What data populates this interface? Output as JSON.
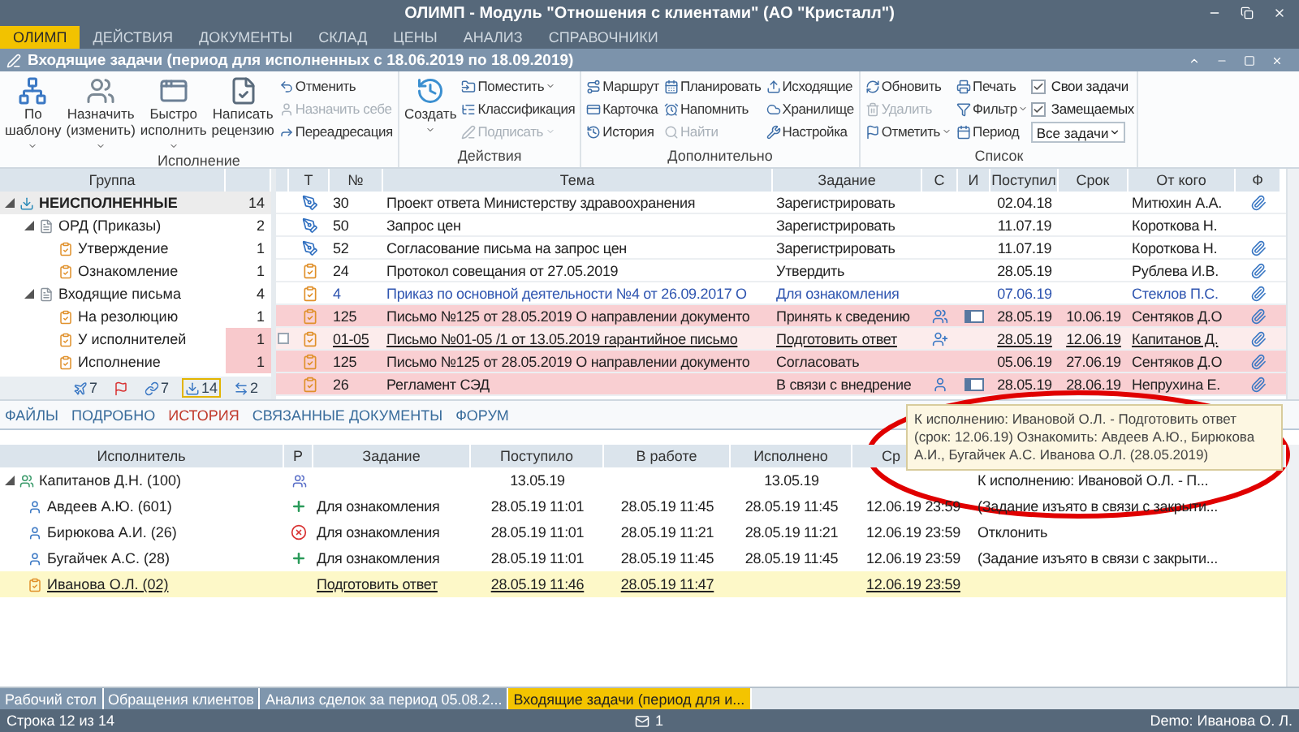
{
  "window": {
    "title": "ОЛИМП -  Модуль \"Отношения с клиентами\" (АО \"Кристалл\")"
  },
  "menu": [
    {
      "label": "ОЛИМП",
      "selected": true
    },
    {
      "label": "ДЕЙСТВИЯ",
      "selected": false
    },
    {
      "label": "ДОКУМЕНТЫ",
      "selected": false
    },
    {
      "label": "СКЛАД",
      "selected": false
    },
    {
      "label": "ЦЕНЫ",
      "selected": false
    },
    {
      "label": "АНАЛИЗ",
      "selected": false
    },
    {
      "label": "СПРАВОЧНИКИ",
      "selected": false
    }
  ],
  "document_title": "Входящие задачи (период для исполненных с 18.06.2019 по 18.09.2019)",
  "ribbon": {
    "groups": [
      {
        "label": "Исполнение",
        "items": [
          {
            "kind": "big",
            "label": "По шаблону",
            "dropdown": true
          },
          {
            "kind": "big",
            "label": "Назначить (изменить)",
            "dropdown": true
          },
          {
            "kind": "big",
            "label": "Быстро исполнить",
            "dropdown": true
          },
          {
            "kind": "big",
            "label": "Написать рецензию",
            "dropdown": false
          },
          {
            "kind": "column",
            "buttons": [
              {
                "label": "Отменить",
                "disabled": false,
                "dropdown": false
              },
              {
                "label": "Назначить себе",
                "disabled": true,
                "dropdown": false
              },
              {
                "label": "Переадресация",
                "disabled": false,
                "dropdown": false
              }
            ]
          }
        ]
      },
      {
        "label": "Действия",
        "items": [
          {
            "kind": "big",
            "label": "Создать",
            "dropdown": true
          },
          {
            "kind": "column",
            "buttons": [
              {
                "label": "Поместить",
                "disabled": false,
                "dropdown": true
              },
              {
                "label": "Классификация",
                "disabled": false,
                "dropdown": false
              },
              {
                "label": "Подписать",
                "disabled": true,
                "dropdown": true
              }
            ]
          }
        ]
      },
      {
        "label": "Дополнительно",
        "items": [
          {
            "kind": "column",
            "buttons": [
              {
                "label": "Маршрут",
                "disabled": false,
                "dropdown": false
              },
              {
                "label": "Карточка",
                "disabled": false,
                "dropdown": false
              },
              {
                "label": "История",
                "disabled": false,
                "dropdown": false
              }
            ]
          },
          {
            "kind": "column",
            "buttons": [
              {
                "label": "Планировать",
                "disabled": false,
                "dropdown": false
              },
              {
                "label": "Напомнить",
                "disabled": false,
                "dropdown": false
              },
              {
                "label": "Найти",
                "disabled": true,
                "dropdown": false
              }
            ]
          },
          {
            "kind": "column",
            "buttons": [
              {
                "label": "Исходящие",
                "disabled": false,
                "dropdown": false
              },
              {
                "label": "Хранилище",
                "disabled": false,
                "dropdown": false
              },
              {
                "label": "Настройка",
                "disabled": false,
                "dropdown": false
              }
            ]
          }
        ]
      },
      {
        "label": "Список",
        "items": [
          {
            "kind": "column",
            "buttons": [
              {
                "label": "Обновить",
                "disabled": false,
                "dropdown": false
              },
              {
                "label": "Удалить",
                "disabled": true,
                "dropdown": false
              },
              {
                "label": "Отметить",
                "disabled": false,
                "dropdown": true
              }
            ]
          },
          {
            "kind": "column",
            "buttons": [
              {
                "label": "Печать",
                "disabled": false,
                "dropdown": false
              },
              {
                "label": "Фильтр",
                "disabled": false,
                "dropdown": true
              },
              {
                "label": "Период",
                "disabled": false,
                "dropdown": false
              }
            ]
          },
          {
            "kind": "options",
            "checks": [
              {
                "label": "Свои задачи",
                "checked": true
              },
              {
                "label": "Замещаемых",
                "checked": true
              }
            ],
            "select": {
              "value": "Все задачи"
            }
          }
        ]
      }
    ]
  },
  "groups_panel": {
    "header": "Группа",
    "tree": [
      {
        "label": "НЕИСПОЛНЕННЫЕ",
        "count": "14",
        "expanded": true,
        "selected": true,
        "overdue": false,
        "children": [
          {
            "label": "ОРД (Приказы)",
            "count": "2",
            "expanded": true,
            "selected": false,
            "overdue": false,
            "children": [
              {
                "label": "Утверждение",
                "count": "1",
                "selected": false,
                "overdue": false
              },
              {
                "label": "Ознакомление",
                "count": "1",
                "selected": false,
                "overdue": false
              }
            ]
          },
          {
            "label": "Входящие письма",
            "count": "4",
            "expanded": true,
            "selected": false,
            "overdue": false,
            "children": [
              {
                "label": "На резолюцию",
                "count": "1",
                "selected": false,
                "overdue": false
              },
              {
                "label": "У исполнителей",
                "count": "1",
                "selected": false,
                "overdue": true
              },
              {
                "label": "Исполнение",
                "count": "1",
                "selected": false,
                "overdue": true
              }
            ]
          }
        ]
      }
    ],
    "counters": [
      {
        "count": "7",
        "selected": false
      },
      {
        "selected": false
      },
      {
        "count": "7",
        "selected": false
      },
      {
        "count": "14",
        "selected": true
      },
      {
        "count": "2",
        "selected": false
      }
    ]
  },
  "tasks_table": {
    "columns": [
      "Т",
      "№",
      "Тема",
      "Задание",
      "С",
      "И",
      "Поступил",
      "Срок",
      "От кого",
      "Ф"
    ],
    "rows": [
      {
        "kind": "registration",
        "num": "30",
        "topic": "Проект ответа Министерству здравоохранения",
        "task": "Зарегистрировать",
        "received": "02.04.18",
        "sender": "Митюхин А.А.",
        "attachment": true,
        "overdue": false,
        "unread": false,
        "selected": false
      },
      {
        "kind": "registration",
        "num": "50",
        "topic": "Запрос цен",
        "task": "Зарегистрировать",
        "received": "11.07.19",
        "sender": "Короткова Н.",
        "attachment": false,
        "overdue": false,
        "unread": false,
        "selected": false
      },
      {
        "kind": "registration",
        "num": "52",
        "topic": "Согласование письма на запрос цен",
        "task": "Зарегистрировать",
        "received": "11.07.19",
        "sender": "Короткова Н.",
        "attachment": true,
        "overdue": false,
        "unread": false,
        "selected": false
      },
      {
        "kind": "task",
        "num": "24",
        "topic": "Протокол совещания от 27.05.2019",
        "task": "Утвердить",
        "received": "28.05.19",
        "sender": "Рублева И.В.",
        "attachment": true,
        "overdue": false,
        "unread": false,
        "selected": false
      },
      {
        "kind": "task",
        "num": "4",
        "topic": "Приказ по основной деятельности №4 от 26.09.2017 О",
        "task": "Для ознакомления",
        "received": "07.06.19",
        "sender": "Стеклов П.С.",
        "attachment": true,
        "overdue": false,
        "unread": true,
        "selected": false
      },
      {
        "kind": "task",
        "num": "125",
        "topic": "Письмо №125 от 28.05.2019 О направлении документо",
        "task": "Принять к сведению",
        "signers": {
          "kind": "group"
        },
        "progress": true,
        "received": "28.05.19",
        "due": "10.06.19",
        "sender": "Сентяков Д.О",
        "attachment": true,
        "overdue": true,
        "unread": false,
        "selected": false
      },
      {
        "kind": "task",
        "num": "01-05",
        "topic": "Письмо №01-05 /1 от 13.05.2019 гарантийное письмо",
        "task": "Подготовить ответ",
        "signers": {
          "kind": "group_add"
        },
        "progress": false,
        "received": "28.05.19",
        "due": "12.06.19",
        "sender": "Капитанов Д.",
        "attachment": true,
        "overdue": true,
        "unread": false,
        "selected": true
      },
      {
        "kind": "task",
        "num": "125",
        "topic": "Письмо №125 от 28.05.2019 О направлении документо",
        "task": "Согласовать",
        "received": "05.06.19",
        "due": "27.06.19",
        "sender": "Сентяков Д.О",
        "attachment": true,
        "overdue": true,
        "unread": false,
        "selected": false
      },
      {
        "kind": "task",
        "num": "26",
        "topic": "Регламент СЭД",
        "task": "В связи с внедрение",
        "signers": {
          "kind": "person"
        },
        "progress": true,
        "received": "28.05.19",
        "due": "28.06.19",
        "sender": "Непрухина Е.",
        "attachment": true,
        "overdue": true,
        "unread": false,
        "selected": false
      }
    ]
  },
  "detail": {
    "tabs": [
      {
        "label": "ФАЙЛЫ",
        "selected": false
      },
      {
        "label": "ПОДРОБНО",
        "selected": false
      },
      {
        "label": "ИСТОРИЯ",
        "selected": true
      },
      {
        "label": "СВЯЗАННЫЕ ДОКУМЕНТЫ",
        "selected": false
      },
      {
        "label": "ФОРУМ",
        "selected": false
      }
    ],
    "history": {
      "columns": [
        "Исполнитель",
        "Р",
        "Задание",
        "Поступило",
        "В работе",
        "Исполнено",
        "Ср"
      ],
      "rows": [
        {
          "name": "Капитанов Д.Н. (100)",
          "expanded": true,
          "resolution": {
            "kind": "assigned"
          },
          "received": "13.05.19",
          "done": "13.05.19",
          "note": "К исполнению:  Ивановой О.Л. - П...",
          "selected": false,
          "children": [
            {
              "name": "Авдеев А.Ю. (601)",
              "resolution": {
                "kind": "accepted"
              },
              "task": "Для ознакомления",
              "received": "28.05.19 11:01",
              "in_work": "28.05.19 11:45",
              "done": "28.05.19 11:45",
              "due": "12.06.19 23:59",
              "note": "(Задание изъято в связи с закрыти...",
              "selected": false
            },
            {
              "name": "Бирюкова А.И. (26)",
              "resolution": {
                "kind": "rejected"
              },
              "task": "Для ознакомления",
              "received": "28.05.19 11:01",
              "in_work": "28.05.19 11:21",
              "done": "28.05.19 11:21",
              "due": "12.06.19 23:59",
              "note": "Отклонить",
              "selected": false
            },
            {
              "name": "Бугайчек А.С. (28)",
              "resolution": {
                "kind": "accepted"
              },
              "task": "Для ознакомления",
              "received": "28.05.19 11:01",
              "in_work": "28.05.19 11:45",
              "done": "28.05.19 11:45",
              "due": "12.06.19 23:59",
              "note": "(Задание изъято в связи с закрыти...",
              "selected": false
            },
            {
              "name": "Иванова О.Л. (02)",
              "task": "Подготовить ответ",
              "received": "28.05.19 11:46",
              "in_work": "28.05.19 11:47",
              "due": "12.06.19 23:59",
              "selected": true
            }
          ]
        }
      ]
    },
    "tooltip": "К исполнению:  Ивановой О.Л. - Подготовить ответ (срок: 12.06.19) Ознакомить:  Авдеев А.Ю., Бирюкова А.И., Бугайчек А.С. Иванова О.Л. (28.05.2019)"
  },
  "taskbar": [
    {
      "label": "Рабочий стол",
      "selected": false
    },
    {
      "label": "Обращения клиентов",
      "selected": false
    },
    {
      "label": "Анализ сделок за период 05.08.2...",
      "selected": false
    },
    {
      "label": "Входящие задачи (период для и...",
      "selected": true
    }
  ],
  "status_bar": {
    "position": "Строка 12 из 14",
    "messages": "1",
    "user": "Demo: Иванова О. Л."
  }
}
